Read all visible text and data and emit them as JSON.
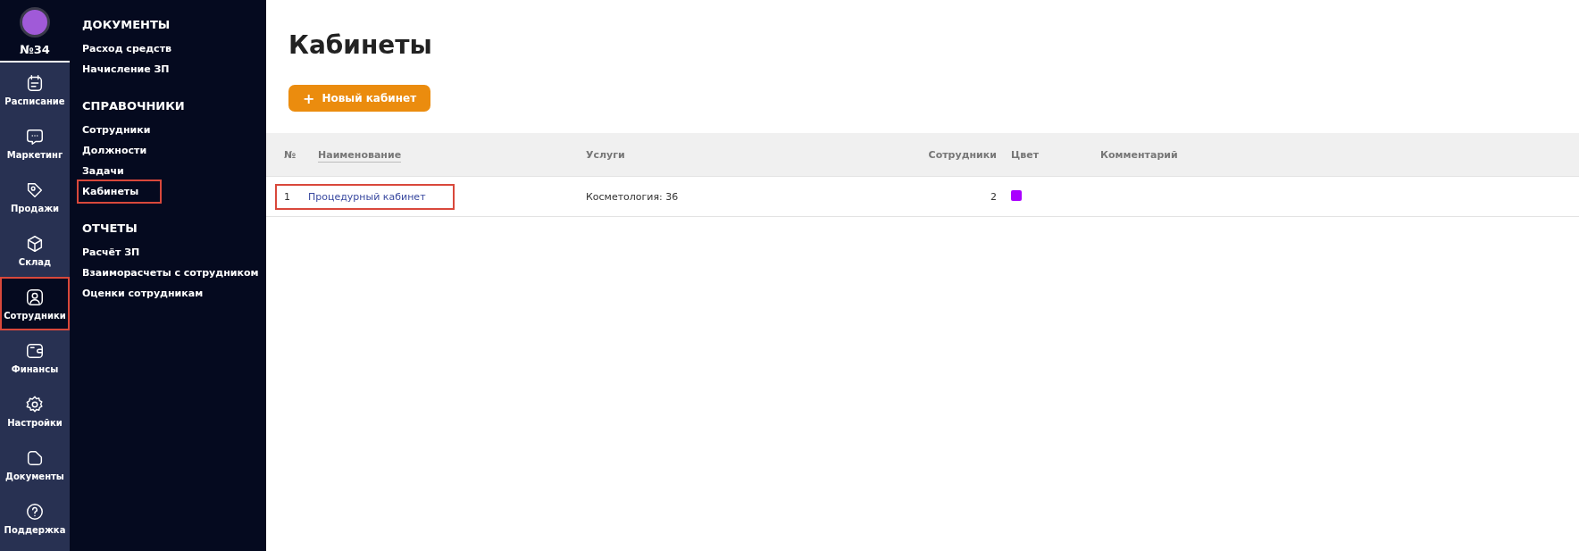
{
  "account": {
    "label": "№34"
  },
  "nav": [
    {
      "label": "Расписание",
      "kind": "calendar",
      "highlighted": false
    },
    {
      "label": "Маркетинг",
      "kind": "chat",
      "highlighted": false
    },
    {
      "label": "Продажи",
      "kind": "tag",
      "highlighted": false
    },
    {
      "label": "Склад",
      "kind": "box",
      "highlighted": false
    },
    {
      "label": "Сотрудники",
      "kind": "user",
      "highlighted": true
    },
    {
      "label": "Финансы",
      "kind": "wallet",
      "highlighted": false
    },
    {
      "label": "Настройки",
      "kind": "gear",
      "highlighted": false
    },
    {
      "label": "Документы",
      "kind": "folder",
      "highlighted": false
    },
    {
      "label": "Поддержка",
      "kind": "help",
      "highlighted": false
    }
  ],
  "submenu": [
    {
      "heading": "ДОКУМЕНТЫ",
      "items": [
        {
          "label": "Расход средств",
          "highlighted": false
        },
        {
          "label": "Начисление ЗП",
          "highlighted": false
        }
      ]
    },
    {
      "heading": "СПРАВОЧНИКИ",
      "items": [
        {
          "label": "Сотрудники",
          "highlighted": false
        },
        {
          "label": "Должности",
          "highlighted": false
        },
        {
          "label": "Задачи",
          "highlighted": false
        },
        {
          "label": "Кабинеты",
          "highlighted": true
        }
      ]
    },
    {
      "heading": "ОТЧЕТЫ",
      "items": [
        {
          "label": "Расчёт ЗП",
          "highlighted": false
        },
        {
          "label": "Взаиморасчеты с сотрудником",
          "highlighted": false
        },
        {
          "label": "Оценки сотрудникам",
          "highlighted": false
        }
      ]
    }
  ],
  "page": {
    "title": "Кабинеты",
    "new_button": {
      "icon": "+",
      "label": "Новый кабинет"
    }
  },
  "table": {
    "columns": [
      "№",
      "Наименование",
      "Услуги",
      "Сотрудники",
      "Цвет",
      "Комментарий"
    ],
    "rows": [
      {
        "number": "1",
        "name": "Процедурный кабинет",
        "services": "Косметология: 36",
        "staff": "2",
        "color": "#aa00ff",
        "highlighted": true
      }
    ]
  }
}
